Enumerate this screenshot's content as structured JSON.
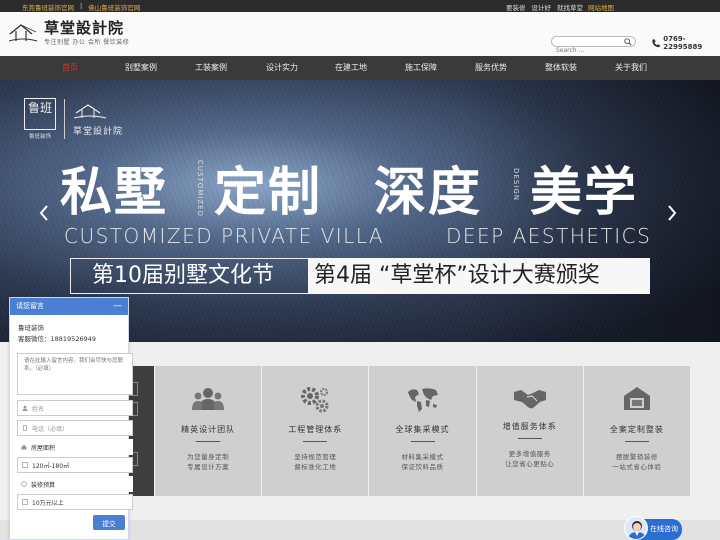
{
  "topbar": {
    "left_links": [
      "东莞鲁班装饰官网",
      "|",
      "佛山鲁班装饰官网"
    ],
    "right_links": [
      "要装修",
      "设计好",
      "就找草堂"
    ],
    "sitemap": "网站地图"
  },
  "header": {
    "logo_name": "草堂設計院",
    "logo_tagline": "专注别墅 办公 会所 餐饮装修",
    "search_placeholder": "Search ...",
    "phone": "0769-22995889"
  },
  "nav": {
    "items": [
      "首页",
      "别墅案例",
      "工装案例",
      "设计实力",
      "在建工地",
      "施工保障",
      "服务优势",
      "整体软装",
      "关于我们"
    ],
    "active_index": 0,
    "active_color": "#e12c2c"
  },
  "banner": {
    "seal_text": "鲁班",
    "seal_sub": "鲁班装饰",
    "brand": "草堂設計院",
    "headline_1": "私墅",
    "headline_2": "定制",
    "headline_3": "深度",
    "headline_4": "美学",
    "vertical_1": "CUSTOMIZED",
    "vertical_2": "DESIGN",
    "en_sub_1": "CUSTOMIZED PRIVATE VILLA",
    "en_sub_2": "DEEP AESTHETICS",
    "ribbon_left": "第10届别墅文化节",
    "ribbon_right": "第4届 “草堂杯”设计大赛颁奖"
  },
  "services": [
    {
      "icon": "team-icon",
      "title": "精英设计团队",
      "desc1": "为您量身定制",
      "desc2": "专属设计方案"
    },
    {
      "icon": "gears-icon",
      "title": "工程管理体系",
      "desc1": "坚持规范管理",
      "desc2": "督标准化工地"
    },
    {
      "icon": "world-map-icon",
      "title": "全球集采模式",
      "desc1": "材料集采模式",
      "desc2": "保证饮料品质"
    },
    {
      "icon": "handshake-icon",
      "title": "增值服务体系",
      "desc1": "更多增值服务",
      "desc2": "让您省心更贴心"
    },
    {
      "icon": "house-box-icon",
      "title": "全案定制整装",
      "desc1": "摆脱繁琐装修",
      "desc2": "一站式省心体验"
    }
  ],
  "chat": {
    "title": "请您留言",
    "minimize": "—",
    "company": "鲁班装饰",
    "wechat_label": "客服微信：18819526949",
    "message_placeholder": "请在此输入留言内容，我们会尽快与您联系。（必填）",
    "name_placeholder": "姓名",
    "phone_placeholder": "电话（必填）",
    "area_label": "房屋面积",
    "area_value": "120㎡-180㎡",
    "budget_label": "装修预算",
    "budget_value": "10万元以上",
    "submit": "提交"
  },
  "consult": {
    "label": "在线咨询"
  },
  "colors": {
    "brand_gold": "#d8b04c",
    "nav_bg": "#3a3a3a",
    "chat_blue": "#4a7fd1",
    "consult_blue": "#2c6dd1"
  }
}
